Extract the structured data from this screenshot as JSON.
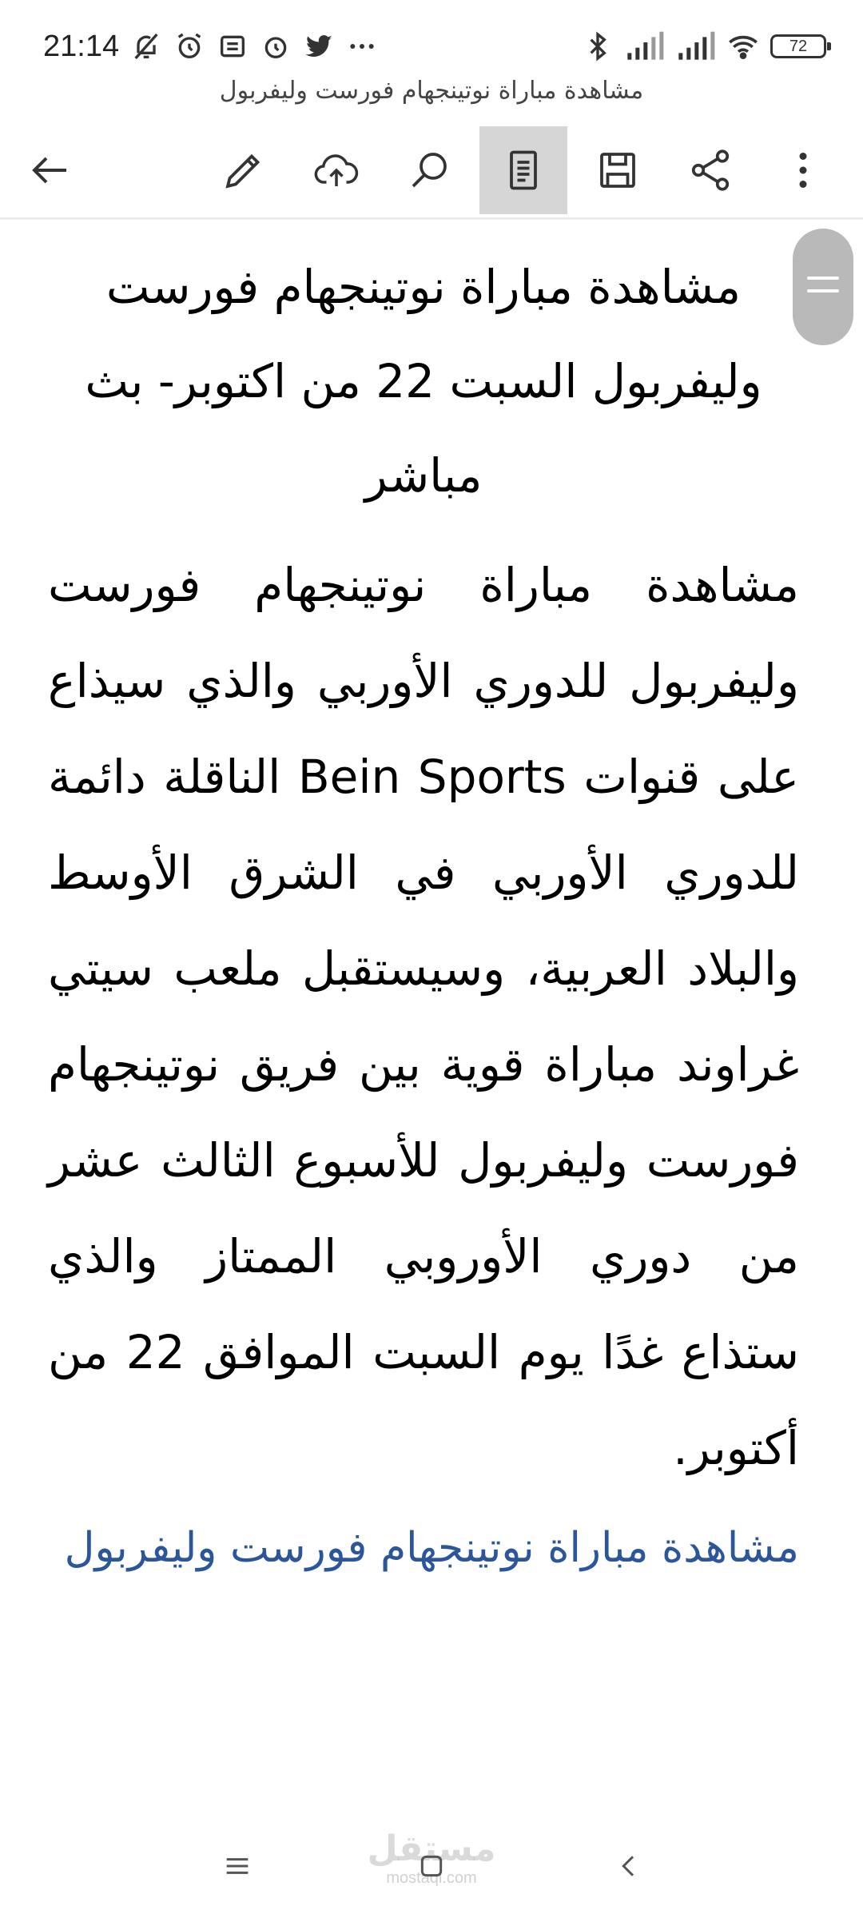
{
  "status_bar": {
    "time": "21:14",
    "battery": "72",
    "icons": [
      "bell-off-icon",
      "alarm-icon",
      "notes-icon",
      "alarm-icon",
      "twitter-icon",
      "more-dots-icon",
      "bluetooth-icon",
      "signal-icon",
      "signal-icon",
      "wifi-icon",
      "battery-icon"
    ]
  },
  "document": {
    "title": "مشاهدة مباراة نوتينجهام فورست وليفربول"
  },
  "toolbar": {
    "icons": [
      "back-arrow-icon",
      "pencil-icon",
      "cloud-upload-icon",
      "search-icon",
      "reading-view-icon",
      "save-icon",
      "share-icon",
      "more-vertical-icon"
    ],
    "active": "reading-view-icon"
  },
  "content": {
    "heading": "مشاهدة مباراة نوتينجهام فورست وليفربول السبت 22 من اكتوبر- بث مباشر",
    "paragraph": "مشاهدة مباراة نوتينجهام فورست وليفربول للدوري الأوربي والذي سيذاع على قنوات Bein Sports الناقلة دائمة للدوري الأوربي في الشرق الأوسط والبلاد العربية، وسيستقبل ملعب سيتي غراوند مباراة قوية بين فريق نوتينجهام فورست وليفربول للأسبوع الثالث عشر من دوري الأوروبي الممتاز والذي ستذاع غدًا يوم السبت الموافق 22 من أكتوبر.",
    "link_heading": "مشاهدة مباراة نوتينجهام فورست وليفربول"
  },
  "colors": {
    "link": "#2b579a",
    "active_toolbar_bg": "#d6d6d6",
    "scroll_handle": "#b9b9b9"
  },
  "watermark": {
    "arabic": "مستقل",
    "latin": "mostaql.com"
  },
  "nav_bar": {
    "icons": [
      "menu-icon",
      "home-icon",
      "back-icon"
    ]
  }
}
